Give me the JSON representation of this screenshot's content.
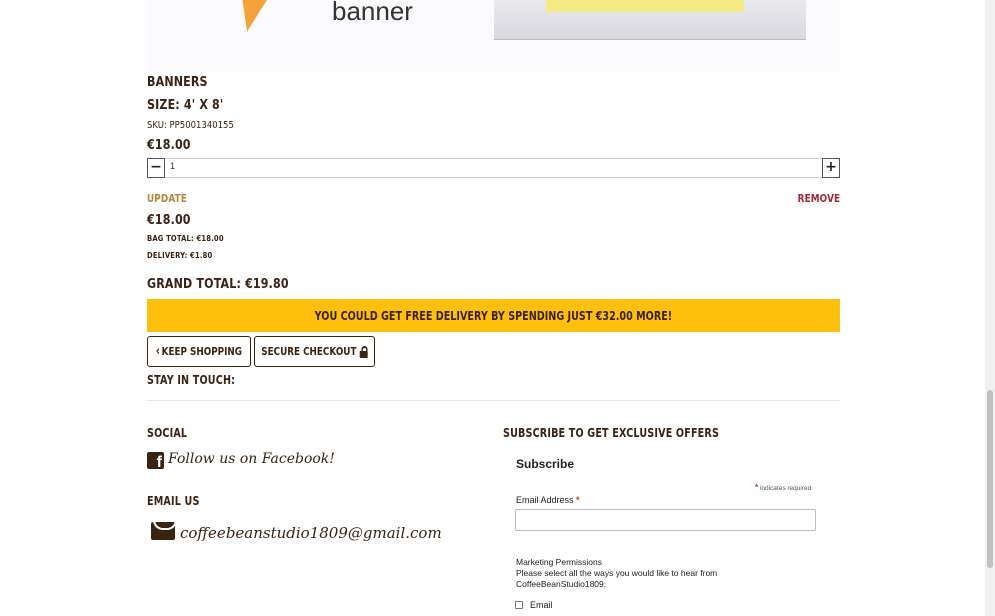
{
  "product_image": {
    "banner_text": "banner"
  },
  "product": {
    "name": "BANNERS",
    "size": "SIZE: 4' X 8'",
    "sku": "SKU: PP5001340155",
    "price": "€18.00",
    "quantity": "1",
    "minus_label": "−",
    "plus_label": "+",
    "update_label": "UPDATE",
    "remove_label": "REMOVE",
    "subtotal": "€18.00"
  },
  "totals": {
    "bag_total": "BAG TOTAL: €18.00",
    "delivery": "DELIVERY: €1.80",
    "grand_total": "GRAND TOTAL: €19.80",
    "free_delivery_message": "YOU COULD GET FREE DELIVERY BY SPENDING JUST €32.00 MORE!"
  },
  "actions": {
    "keep_shopping": "KEEP SHOPPING",
    "secure_checkout": "SECURE CHECKOUT"
  },
  "footer": {
    "stay_in_touch": "STAY IN TOUCH:",
    "social_heading": "SOCIAL",
    "facebook_link": "Follow us on Facebook!",
    "email_heading": "EMAIL US",
    "email_address": "coffeebeanstudio1809@gmail.com",
    "subscribe_heading": "SUBSCRIBE TO GET EXCLUSIVE OFFERS"
  },
  "subscribe_form": {
    "title": "Subscribe",
    "required_note": "indicates required",
    "required_mark": "*",
    "email_label": "Email Address",
    "email_value": "",
    "marketing_title": "Marketing Permissions",
    "marketing_text": "Please select all the ways you would like to hear from CoffeeBeanStudio1809:",
    "option_email": "Email"
  },
  "colors": {
    "brand_brown": "#3b2314",
    "banner_yellow": "#ffc00d",
    "update_gold": "#b0873b",
    "remove_red": "#a3243a"
  }
}
